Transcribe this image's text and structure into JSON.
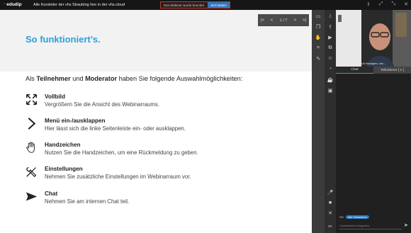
{
  "topbar": {
    "logo": "edudip",
    "title": "Alle Kursleiter der vhs Straubing hier in der vhs.cloud",
    "notice": "Das Webinar wurde beendet",
    "notice_button": "Jetzt starten",
    "icons": [
      "download-icon",
      "fullscreen-icon",
      "fullscreen-icon",
      "close-icon"
    ]
  },
  "nav": {
    "page": "1 / 7"
  },
  "slide": {
    "title": "So funktioniert’s.",
    "lead_prefix": "Als ",
    "lead_role1": "Teilnehmer",
    "lead_mid": " und ",
    "lead_role2": "Moderator",
    "lead_suffix": " haben Sie folgende Auswahlmöglichkeiten:",
    "items": [
      {
        "title": "Vollbild",
        "desc": "Vergrößern Sie die Ansicht des Webinarraums.",
        "icon": "expand-arrows-icon"
      },
      {
        "title": "Menü ein-/ausklappen",
        "desc": "Hier lässt sich die linke Seitenleiste ein- oder ausklappen.",
        "icon": "chevron-right-icon"
      },
      {
        "title": "Handzeichen",
        "desc": "Nutzen Sie die Handzeichen, um eine Rückmeldung zu geben.",
        "icon": "hand-icon"
      },
      {
        "title": "Einstellungen",
        "desc": "Nehmen Sie zusätzliche Einstellungen im Webinarraum vor.",
        "icon": "tools-icon"
      },
      {
        "title": "Chat",
        "desc": "Nehmen Sie am internen Chat teil.",
        "icon": "send-icon"
      }
    ]
  },
  "panel": {
    "presenter": "Uli Holzapfel, vhs ...",
    "tab_chat": "Chat",
    "tab_participants": "Teilnehmer [ 1 ]",
    "chat_to_label": "An:",
    "chat_to_value": "Alle Teilnehmer",
    "chat_placeholder": "Chatnachricht eingeben"
  },
  "colors": {
    "accent": "#2f9fd8",
    "brand": "#e2432f"
  }
}
